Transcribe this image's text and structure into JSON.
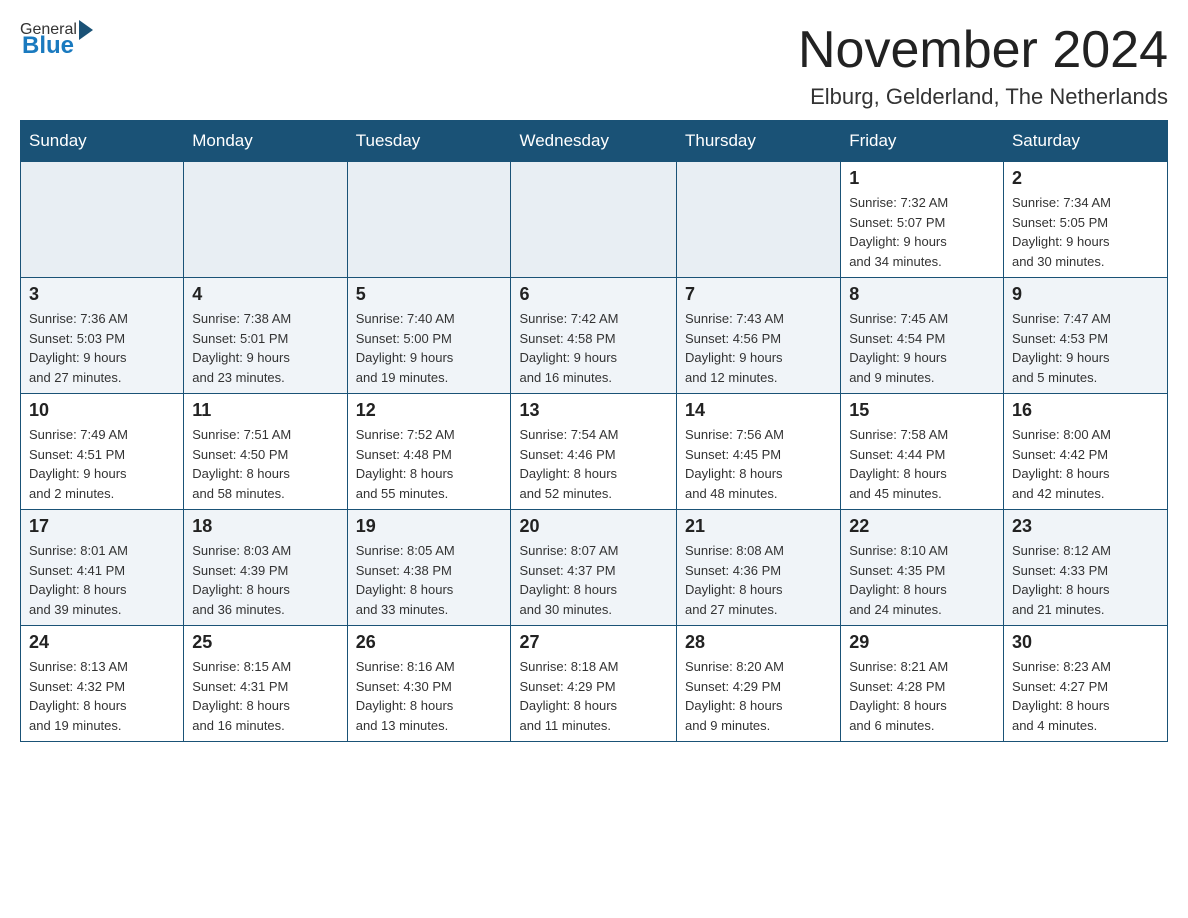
{
  "header": {
    "logo_general": "General",
    "logo_blue": "Blue",
    "month_title": "November 2024",
    "location": "Elburg, Gelderland, The Netherlands"
  },
  "weekdays": [
    "Sunday",
    "Monday",
    "Tuesday",
    "Wednesday",
    "Thursday",
    "Friday",
    "Saturday"
  ],
  "weeks": [
    [
      {
        "day": "",
        "info": ""
      },
      {
        "day": "",
        "info": ""
      },
      {
        "day": "",
        "info": ""
      },
      {
        "day": "",
        "info": ""
      },
      {
        "day": "",
        "info": ""
      },
      {
        "day": "1",
        "info": "Sunrise: 7:32 AM\nSunset: 5:07 PM\nDaylight: 9 hours\nand 34 minutes."
      },
      {
        "day": "2",
        "info": "Sunrise: 7:34 AM\nSunset: 5:05 PM\nDaylight: 9 hours\nand 30 minutes."
      }
    ],
    [
      {
        "day": "3",
        "info": "Sunrise: 7:36 AM\nSunset: 5:03 PM\nDaylight: 9 hours\nand 27 minutes."
      },
      {
        "day": "4",
        "info": "Sunrise: 7:38 AM\nSunset: 5:01 PM\nDaylight: 9 hours\nand 23 minutes."
      },
      {
        "day": "5",
        "info": "Sunrise: 7:40 AM\nSunset: 5:00 PM\nDaylight: 9 hours\nand 19 minutes."
      },
      {
        "day": "6",
        "info": "Sunrise: 7:42 AM\nSunset: 4:58 PM\nDaylight: 9 hours\nand 16 minutes."
      },
      {
        "day": "7",
        "info": "Sunrise: 7:43 AM\nSunset: 4:56 PM\nDaylight: 9 hours\nand 12 minutes."
      },
      {
        "day": "8",
        "info": "Sunrise: 7:45 AM\nSunset: 4:54 PM\nDaylight: 9 hours\nand 9 minutes."
      },
      {
        "day": "9",
        "info": "Sunrise: 7:47 AM\nSunset: 4:53 PM\nDaylight: 9 hours\nand 5 minutes."
      }
    ],
    [
      {
        "day": "10",
        "info": "Sunrise: 7:49 AM\nSunset: 4:51 PM\nDaylight: 9 hours\nand 2 minutes."
      },
      {
        "day": "11",
        "info": "Sunrise: 7:51 AM\nSunset: 4:50 PM\nDaylight: 8 hours\nand 58 minutes."
      },
      {
        "day": "12",
        "info": "Sunrise: 7:52 AM\nSunset: 4:48 PM\nDaylight: 8 hours\nand 55 minutes."
      },
      {
        "day": "13",
        "info": "Sunrise: 7:54 AM\nSunset: 4:46 PM\nDaylight: 8 hours\nand 52 minutes."
      },
      {
        "day": "14",
        "info": "Sunrise: 7:56 AM\nSunset: 4:45 PM\nDaylight: 8 hours\nand 48 minutes."
      },
      {
        "day": "15",
        "info": "Sunrise: 7:58 AM\nSunset: 4:44 PM\nDaylight: 8 hours\nand 45 minutes."
      },
      {
        "day": "16",
        "info": "Sunrise: 8:00 AM\nSunset: 4:42 PM\nDaylight: 8 hours\nand 42 minutes."
      }
    ],
    [
      {
        "day": "17",
        "info": "Sunrise: 8:01 AM\nSunset: 4:41 PM\nDaylight: 8 hours\nand 39 minutes."
      },
      {
        "day": "18",
        "info": "Sunrise: 8:03 AM\nSunset: 4:39 PM\nDaylight: 8 hours\nand 36 minutes."
      },
      {
        "day": "19",
        "info": "Sunrise: 8:05 AM\nSunset: 4:38 PM\nDaylight: 8 hours\nand 33 minutes."
      },
      {
        "day": "20",
        "info": "Sunrise: 8:07 AM\nSunset: 4:37 PM\nDaylight: 8 hours\nand 30 minutes."
      },
      {
        "day": "21",
        "info": "Sunrise: 8:08 AM\nSunset: 4:36 PM\nDaylight: 8 hours\nand 27 minutes."
      },
      {
        "day": "22",
        "info": "Sunrise: 8:10 AM\nSunset: 4:35 PM\nDaylight: 8 hours\nand 24 minutes."
      },
      {
        "day": "23",
        "info": "Sunrise: 8:12 AM\nSunset: 4:33 PM\nDaylight: 8 hours\nand 21 minutes."
      }
    ],
    [
      {
        "day": "24",
        "info": "Sunrise: 8:13 AM\nSunset: 4:32 PM\nDaylight: 8 hours\nand 19 minutes."
      },
      {
        "day": "25",
        "info": "Sunrise: 8:15 AM\nSunset: 4:31 PM\nDaylight: 8 hours\nand 16 minutes."
      },
      {
        "day": "26",
        "info": "Sunrise: 8:16 AM\nSunset: 4:30 PM\nDaylight: 8 hours\nand 13 minutes."
      },
      {
        "day": "27",
        "info": "Sunrise: 8:18 AM\nSunset: 4:29 PM\nDaylight: 8 hours\nand 11 minutes."
      },
      {
        "day": "28",
        "info": "Sunrise: 8:20 AM\nSunset: 4:29 PM\nDaylight: 8 hours\nand 9 minutes."
      },
      {
        "day": "29",
        "info": "Sunrise: 8:21 AM\nSunset: 4:28 PM\nDaylight: 8 hours\nand 6 minutes."
      },
      {
        "day": "30",
        "info": "Sunrise: 8:23 AM\nSunset: 4:27 PM\nDaylight: 8 hours\nand 4 minutes."
      }
    ]
  ]
}
